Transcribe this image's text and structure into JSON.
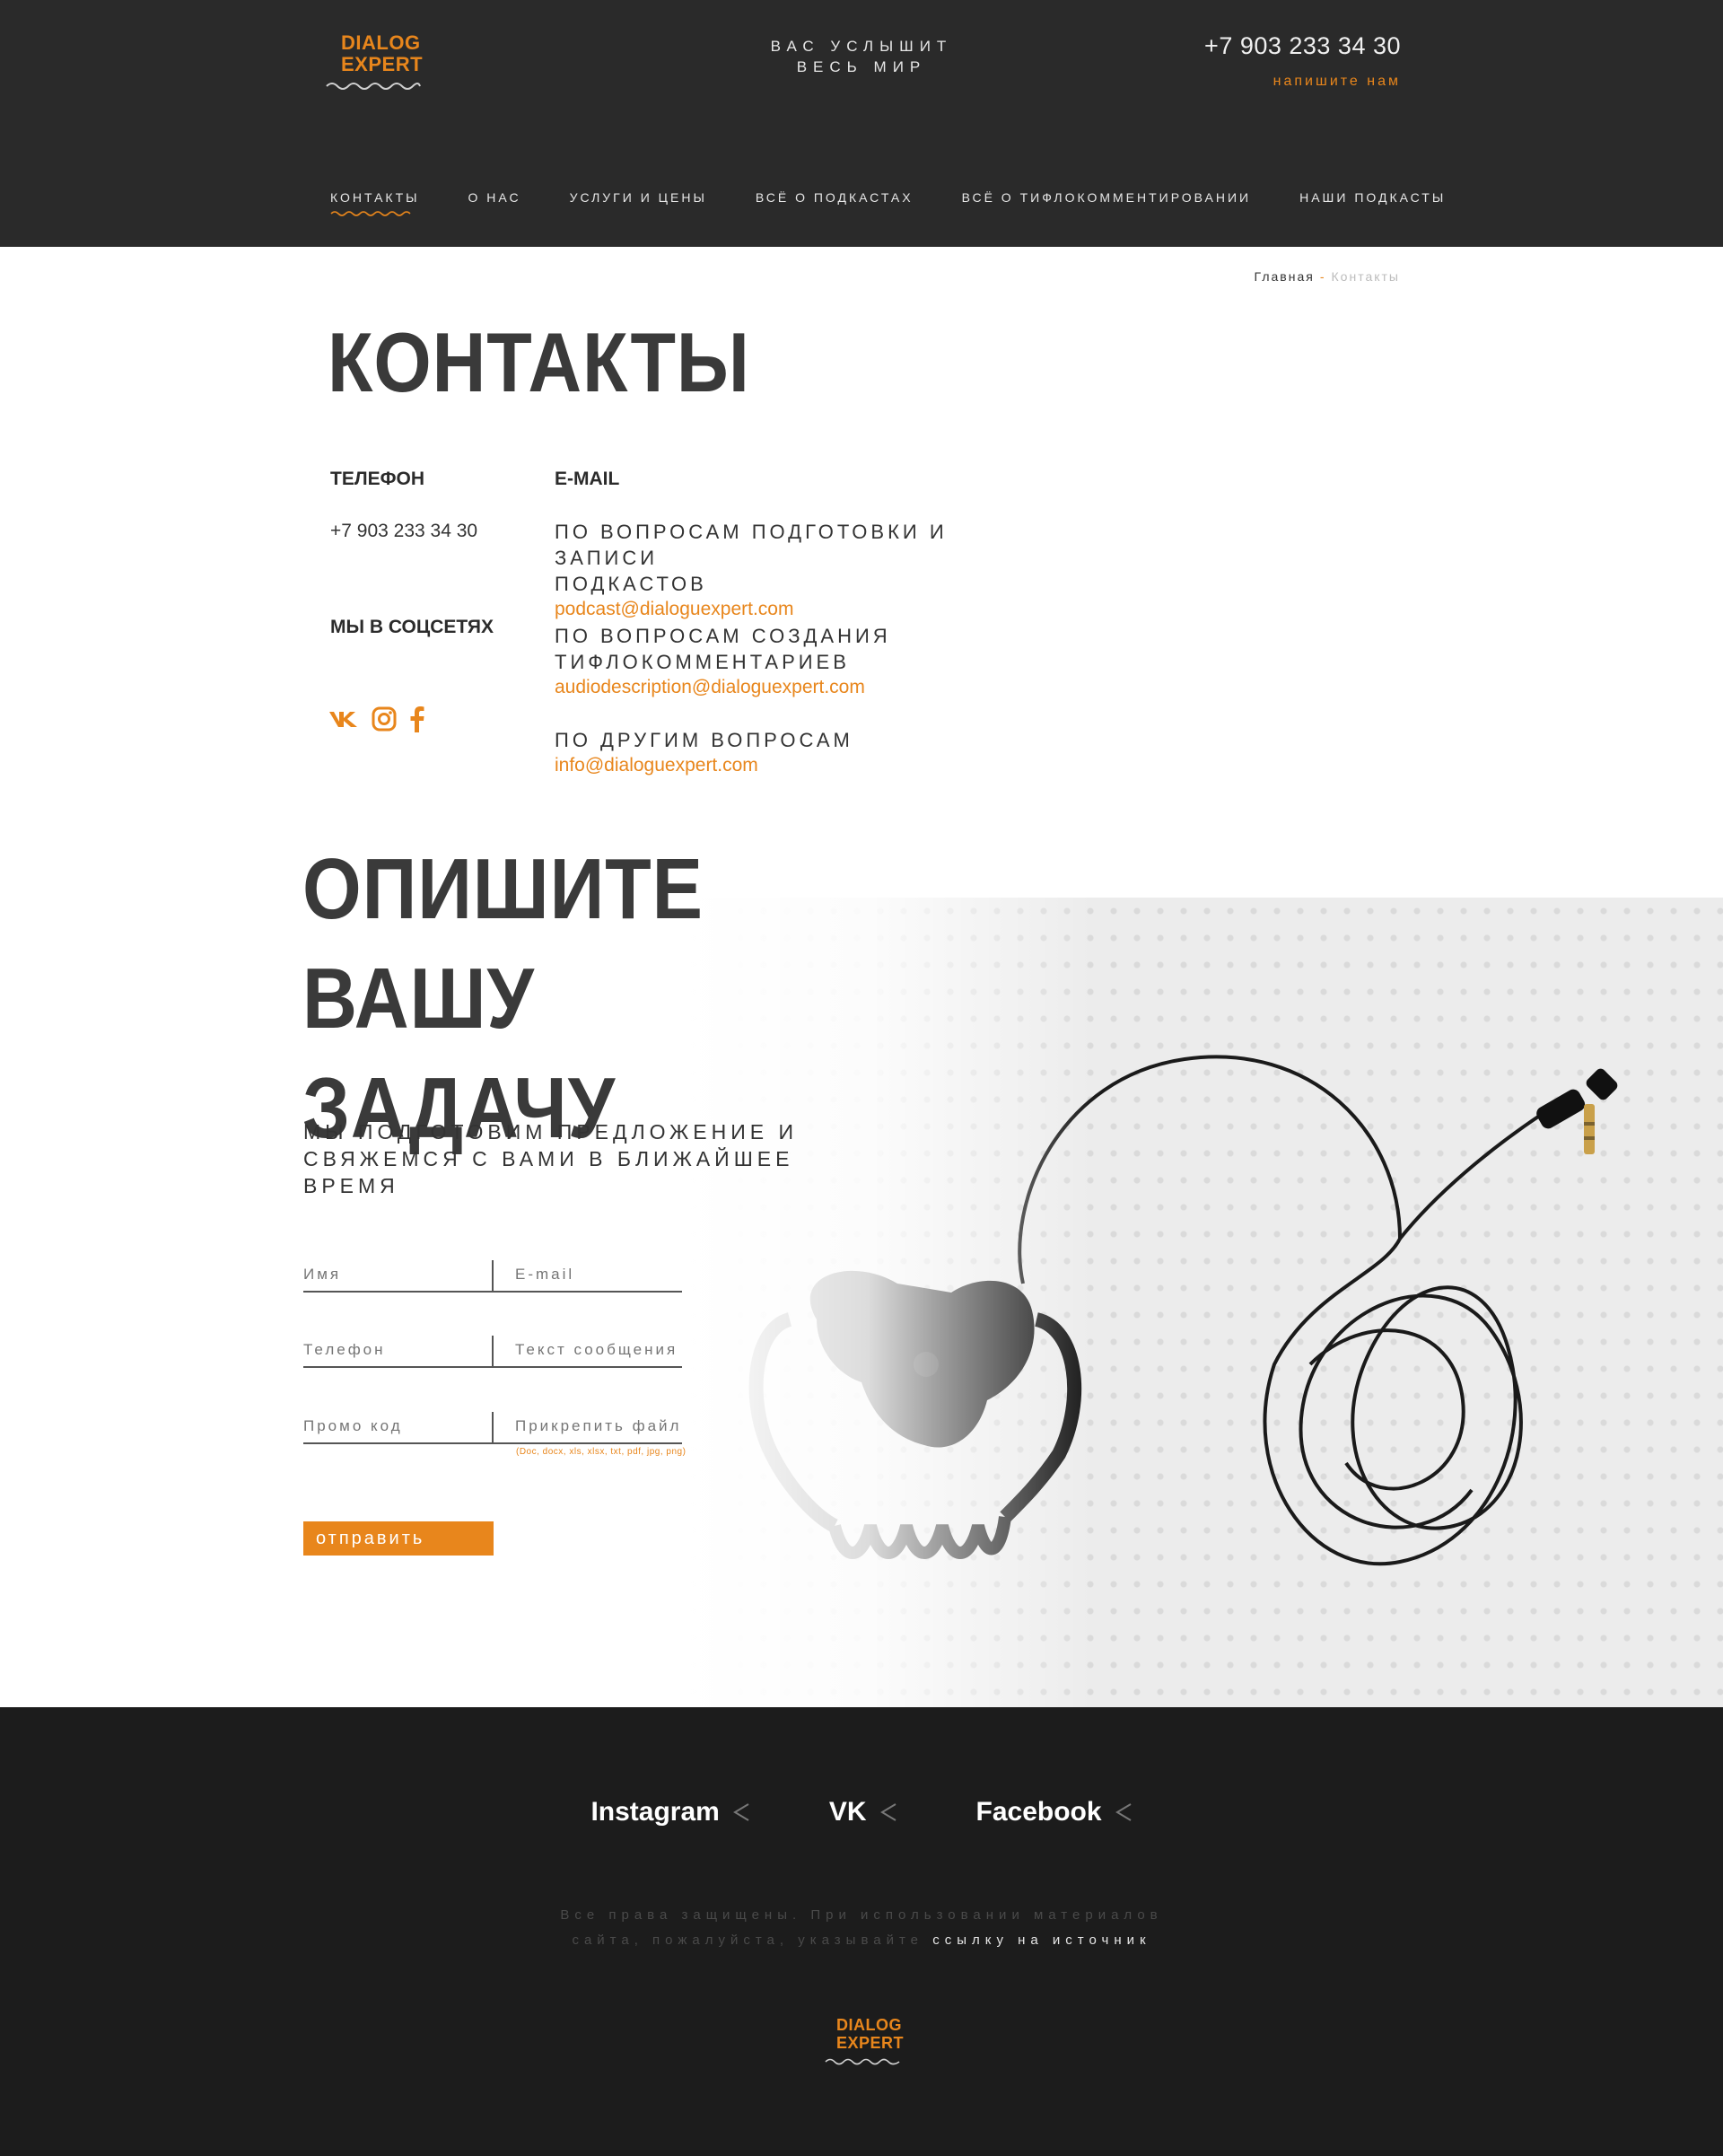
{
  "brand": {
    "logo_line1": "DIALOG",
    "logo_line2": "EXPERT",
    "accent": "#e8861c",
    "dark": "#2a2a2a"
  },
  "header": {
    "tagline_line1": "ВАС УСЛЫШИТ",
    "tagline_line2": "ВЕСЬ МИР",
    "phone": "+7 903 233 34 30",
    "write_us": "напишите нам"
  },
  "nav": {
    "items": [
      {
        "label": "КОНТАКТЫ",
        "active": true
      },
      {
        "label": "О НАС"
      },
      {
        "label": "УСЛУГИ И ЦЕНЫ"
      },
      {
        "label": "ВСЁ О ПОДКАСТАХ"
      },
      {
        "label": "ВСЁ О ТИФЛОКОММЕНТИРОВАНИИ"
      },
      {
        "label": "НАШИ ПОДКАСТЫ"
      }
    ]
  },
  "breadcrumb": {
    "home": "Главная",
    "separator": "-",
    "current": "Контакты"
  },
  "page_title": "КОНТАКТЫ",
  "contacts": {
    "phone_label": "ТЕЛЕФОН",
    "phone_value": "+7 903 233 34 30",
    "social_label": "МЫ В СОЦСЕТЯХ",
    "social_icons": [
      "vk-icon",
      "instagram-icon",
      "facebook-icon"
    ],
    "email_label": "E-MAIL",
    "emails": [
      {
        "question_line1": "ПО ВОПРОСАМ ПОДГОТОВКИ И ЗАПИСИ",
        "question_line2": "ПОДКАСТОВ",
        "address": "podcast@dialoguexpert.com"
      },
      {
        "question_line1": "ПО ВОПРОСАМ СОЗДАНИЯ",
        "question_line2": "ТИФЛОКОММЕНТАРИЕВ",
        "address": "audiodescription@dialoguexpert.com"
      },
      {
        "question_line1": "ПО ДРУГИМ ВОПРОСАМ",
        "question_line2": "",
        "address": "info@dialoguexpert.com"
      }
    ]
  },
  "form": {
    "title_line1": "ОПИШИТЕ ВАШУ",
    "title_line2": "ЗАДАЧУ",
    "subtitle_line1": "МЫ ПОДГОТОВИМ ПРЕДЛОЖЕНИЕ И",
    "subtitle_line2": "СВЯЖЕМСЯ С ВАМИ В БЛИЖАЙШЕЕ ВРЕМЯ",
    "name_placeholder": "Имя",
    "email_placeholder": "E-mail",
    "phone_placeholder": "Телефон",
    "message_placeholder": "Текст сообщения",
    "promo_placeholder": "Промо код",
    "attach_label": "Прикрепить файл",
    "attach_hint": "(Doc, docx, xls, xlsx, txt, pdf, jpg, png)",
    "submit_label": "отправить"
  },
  "footer": {
    "links": [
      "Instagram",
      "VK",
      "Facebook"
    ],
    "copyright_line1": "Все права защищены. При использовании материалов",
    "copyright_line2": "сайта, пожалуйста, указывайте",
    "source_link": "ссылку на источник"
  }
}
